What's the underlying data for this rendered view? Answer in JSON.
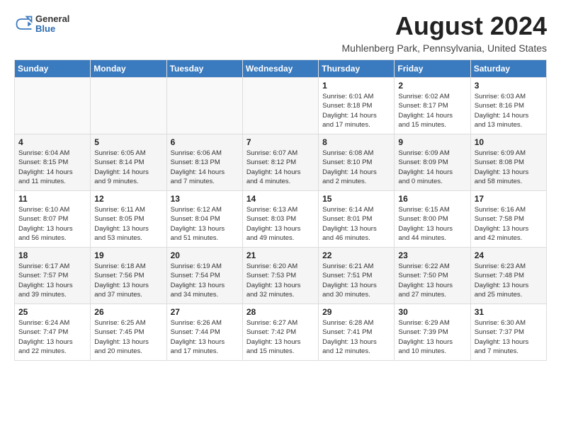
{
  "header": {
    "logo_general": "General",
    "logo_blue": "Blue",
    "title": "August 2024",
    "subtitle": "Muhlenberg Park, Pennsylvania, United States"
  },
  "calendar": {
    "days_of_week": [
      "Sunday",
      "Monday",
      "Tuesday",
      "Wednesday",
      "Thursday",
      "Friday",
      "Saturday"
    ],
    "weeks": [
      [
        {
          "day": "",
          "info": ""
        },
        {
          "day": "",
          "info": ""
        },
        {
          "day": "",
          "info": ""
        },
        {
          "day": "",
          "info": ""
        },
        {
          "day": "1",
          "info": "Sunrise: 6:01 AM\nSunset: 8:18 PM\nDaylight: 14 hours\nand 17 minutes."
        },
        {
          "day": "2",
          "info": "Sunrise: 6:02 AM\nSunset: 8:17 PM\nDaylight: 14 hours\nand 15 minutes."
        },
        {
          "day": "3",
          "info": "Sunrise: 6:03 AM\nSunset: 8:16 PM\nDaylight: 14 hours\nand 13 minutes."
        }
      ],
      [
        {
          "day": "4",
          "info": "Sunrise: 6:04 AM\nSunset: 8:15 PM\nDaylight: 14 hours\nand 11 minutes."
        },
        {
          "day": "5",
          "info": "Sunrise: 6:05 AM\nSunset: 8:14 PM\nDaylight: 14 hours\nand 9 minutes."
        },
        {
          "day": "6",
          "info": "Sunrise: 6:06 AM\nSunset: 8:13 PM\nDaylight: 14 hours\nand 7 minutes."
        },
        {
          "day": "7",
          "info": "Sunrise: 6:07 AM\nSunset: 8:12 PM\nDaylight: 14 hours\nand 4 minutes."
        },
        {
          "day": "8",
          "info": "Sunrise: 6:08 AM\nSunset: 8:10 PM\nDaylight: 14 hours\nand 2 minutes."
        },
        {
          "day": "9",
          "info": "Sunrise: 6:09 AM\nSunset: 8:09 PM\nDaylight: 14 hours\nand 0 minutes."
        },
        {
          "day": "10",
          "info": "Sunrise: 6:09 AM\nSunset: 8:08 PM\nDaylight: 13 hours\nand 58 minutes."
        }
      ],
      [
        {
          "day": "11",
          "info": "Sunrise: 6:10 AM\nSunset: 8:07 PM\nDaylight: 13 hours\nand 56 minutes."
        },
        {
          "day": "12",
          "info": "Sunrise: 6:11 AM\nSunset: 8:05 PM\nDaylight: 13 hours\nand 53 minutes."
        },
        {
          "day": "13",
          "info": "Sunrise: 6:12 AM\nSunset: 8:04 PM\nDaylight: 13 hours\nand 51 minutes."
        },
        {
          "day": "14",
          "info": "Sunrise: 6:13 AM\nSunset: 8:03 PM\nDaylight: 13 hours\nand 49 minutes."
        },
        {
          "day": "15",
          "info": "Sunrise: 6:14 AM\nSunset: 8:01 PM\nDaylight: 13 hours\nand 46 minutes."
        },
        {
          "day": "16",
          "info": "Sunrise: 6:15 AM\nSunset: 8:00 PM\nDaylight: 13 hours\nand 44 minutes."
        },
        {
          "day": "17",
          "info": "Sunrise: 6:16 AM\nSunset: 7:58 PM\nDaylight: 13 hours\nand 42 minutes."
        }
      ],
      [
        {
          "day": "18",
          "info": "Sunrise: 6:17 AM\nSunset: 7:57 PM\nDaylight: 13 hours\nand 39 minutes."
        },
        {
          "day": "19",
          "info": "Sunrise: 6:18 AM\nSunset: 7:56 PM\nDaylight: 13 hours\nand 37 minutes."
        },
        {
          "day": "20",
          "info": "Sunrise: 6:19 AM\nSunset: 7:54 PM\nDaylight: 13 hours\nand 34 minutes."
        },
        {
          "day": "21",
          "info": "Sunrise: 6:20 AM\nSunset: 7:53 PM\nDaylight: 13 hours\nand 32 minutes."
        },
        {
          "day": "22",
          "info": "Sunrise: 6:21 AM\nSunset: 7:51 PM\nDaylight: 13 hours\nand 30 minutes."
        },
        {
          "day": "23",
          "info": "Sunrise: 6:22 AM\nSunset: 7:50 PM\nDaylight: 13 hours\nand 27 minutes."
        },
        {
          "day": "24",
          "info": "Sunrise: 6:23 AM\nSunset: 7:48 PM\nDaylight: 13 hours\nand 25 minutes."
        }
      ],
      [
        {
          "day": "25",
          "info": "Sunrise: 6:24 AM\nSunset: 7:47 PM\nDaylight: 13 hours\nand 22 minutes."
        },
        {
          "day": "26",
          "info": "Sunrise: 6:25 AM\nSunset: 7:45 PM\nDaylight: 13 hours\nand 20 minutes."
        },
        {
          "day": "27",
          "info": "Sunrise: 6:26 AM\nSunset: 7:44 PM\nDaylight: 13 hours\nand 17 minutes."
        },
        {
          "day": "28",
          "info": "Sunrise: 6:27 AM\nSunset: 7:42 PM\nDaylight: 13 hours\nand 15 minutes."
        },
        {
          "day": "29",
          "info": "Sunrise: 6:28 AM\nSunset: 7:41 PM\nDaylight: 13 hours\nand 12 minutes."
        },
        {
          "day": "30",
          "info": "Sunrise: 6:29 AM\nSunset: 7:39 PM\nDaylight: 13 hours\nand 10 minutes."
        },
        {
          "day": "31",
          "info": "Sunrise: 6:30 AM\nSunset: 7:37 PM\nDaylight: 13 hours\nand 7 minutes."
        }
      ]
    ]
  }
}
